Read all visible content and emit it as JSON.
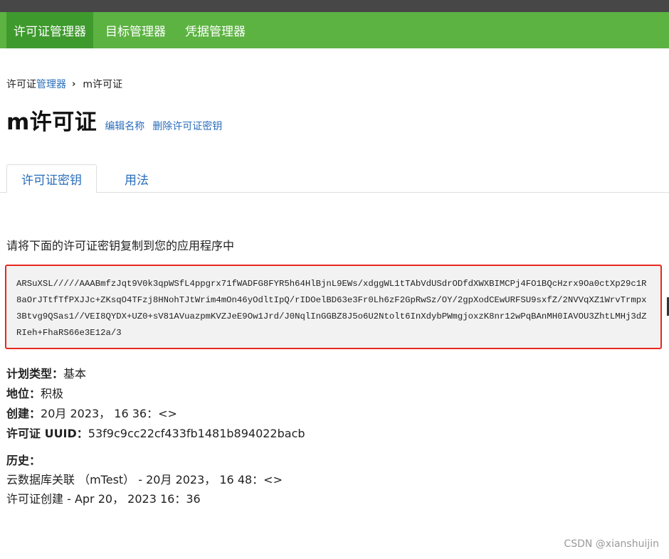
{
  "nav": {
    "items": [
      {
        "label": "许可证管理器",
        "active": true
      },
      {
        "label": "目标管理器",
        "active": false
      },
      {
        "label": "凭据管理器",
        "active": false
      }
    ],
    "bar_color": "#5cb342",
    "active_color": "#3f9a2e"
  },
  "breadcrumb": {
    "prefix": "许可证",
    "link": "管理器",
    "separator": "›",
    "current": "m许可证"
  },
  "header": {
    "title": "m许可证",
    "rename_link": "编辑名称",
    "delete_link": "删除许可证密钥"
  },
  "tabs": [
    {
      "label": "许可证密钥",
      "active": true
    },
    {
      "label": "用法",
      "active": false
    }
  ],
  "license": {
    "instruction": "请将下面的许可证密钥复制到您的应用程序中",
    "key": "ARSuXSL/////AAABmfzJqt9V0k3qpWSfL4ppgrx71fWADFG8FYR5h64HlBjnL9EWs/xdggWL1tTAbVdUSdrODfdXWXBIMCPj4FO1BQcHzrx9Oa0ctXp29c1R8aOrJTtfTfPXJJc+ZKsqO4TFzj8HNohTJtWrim4mOn46yOdltIpQ/rIDOelBD63e3Fr0Lh6zF2GpRwSz/OY/2gpXodCEwURFSU9sxfZ/2NVVqXZ1WrvTrmpx3Btvg9QSas1//VEI8QYDX+UZ0+sV81AVuazpmKVZJeE9Ow1Jrd/J0NqlInGGBZ8J5o6U2Ntolt6InXdybPWmgjoxzK8nr12wPqBAnMH0IAVOU3ZhtLMHj3dZRIeh+FhaRS66e3E12a/3",
    "highlight_color": "#e8281e"
  },
  "details": {
    "plan_type_label": "计划类型：",
    "plan_type_value": "基本",
    "status_label": "地位：",
    "status_value": "积极",
    "created_label": "创建：",
    "created_value": "20月 2023， 16 36：<>",
    "uuid_label": "许可证 UUID：",
    "uuid_value": "53f9c9cc22cf433fb1481b894022bacb"
  },
  "history": {
    "label": "历史：",
    "entries": [
      "云数据库关联 （mTest） - 20月 2023， 16 48：<>",
      "许可证创建 - Apr 20， 2023 16：36"
    ]
  },
  "watermark": "CSDN @xianshuijin"
}
